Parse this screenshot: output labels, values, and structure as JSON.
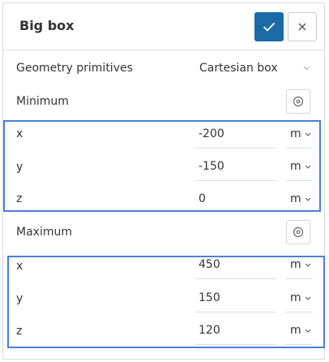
{
  "header": {
    "title": "Big box"
  },
  "geometry": {
    "label": "Geometry primitives",
    "selected": "Cartesian box"
  },
  "minimum": {
    "label": "Minimum",
    "fields": [
      {
        "axis": "x",
        "value": "-200",
        "unit": "m"
      },
      {
        "axis": "y",
        "value": "-150",
        "unit": "m"
      },
      {
        "axis": "z",
        "value": "0",
        "unit": "m"
      }
    ]
  },
  "maximum": {
    "label": "Maximum",
    "fields": [
      {
        "axis": "x",
        "value": "450",
        "unit": "m"
      },
      {
        "axis": "y",
        "value": "150",
        "unit": "m"
      },
      {
        "axis": "z",
        "value": "120",
        "unit": "m"
      }
    ]
  },
  "colors": {
    "accent": "#1a6aa8",
    "highlight": "#4a7fd6"
  }
}
